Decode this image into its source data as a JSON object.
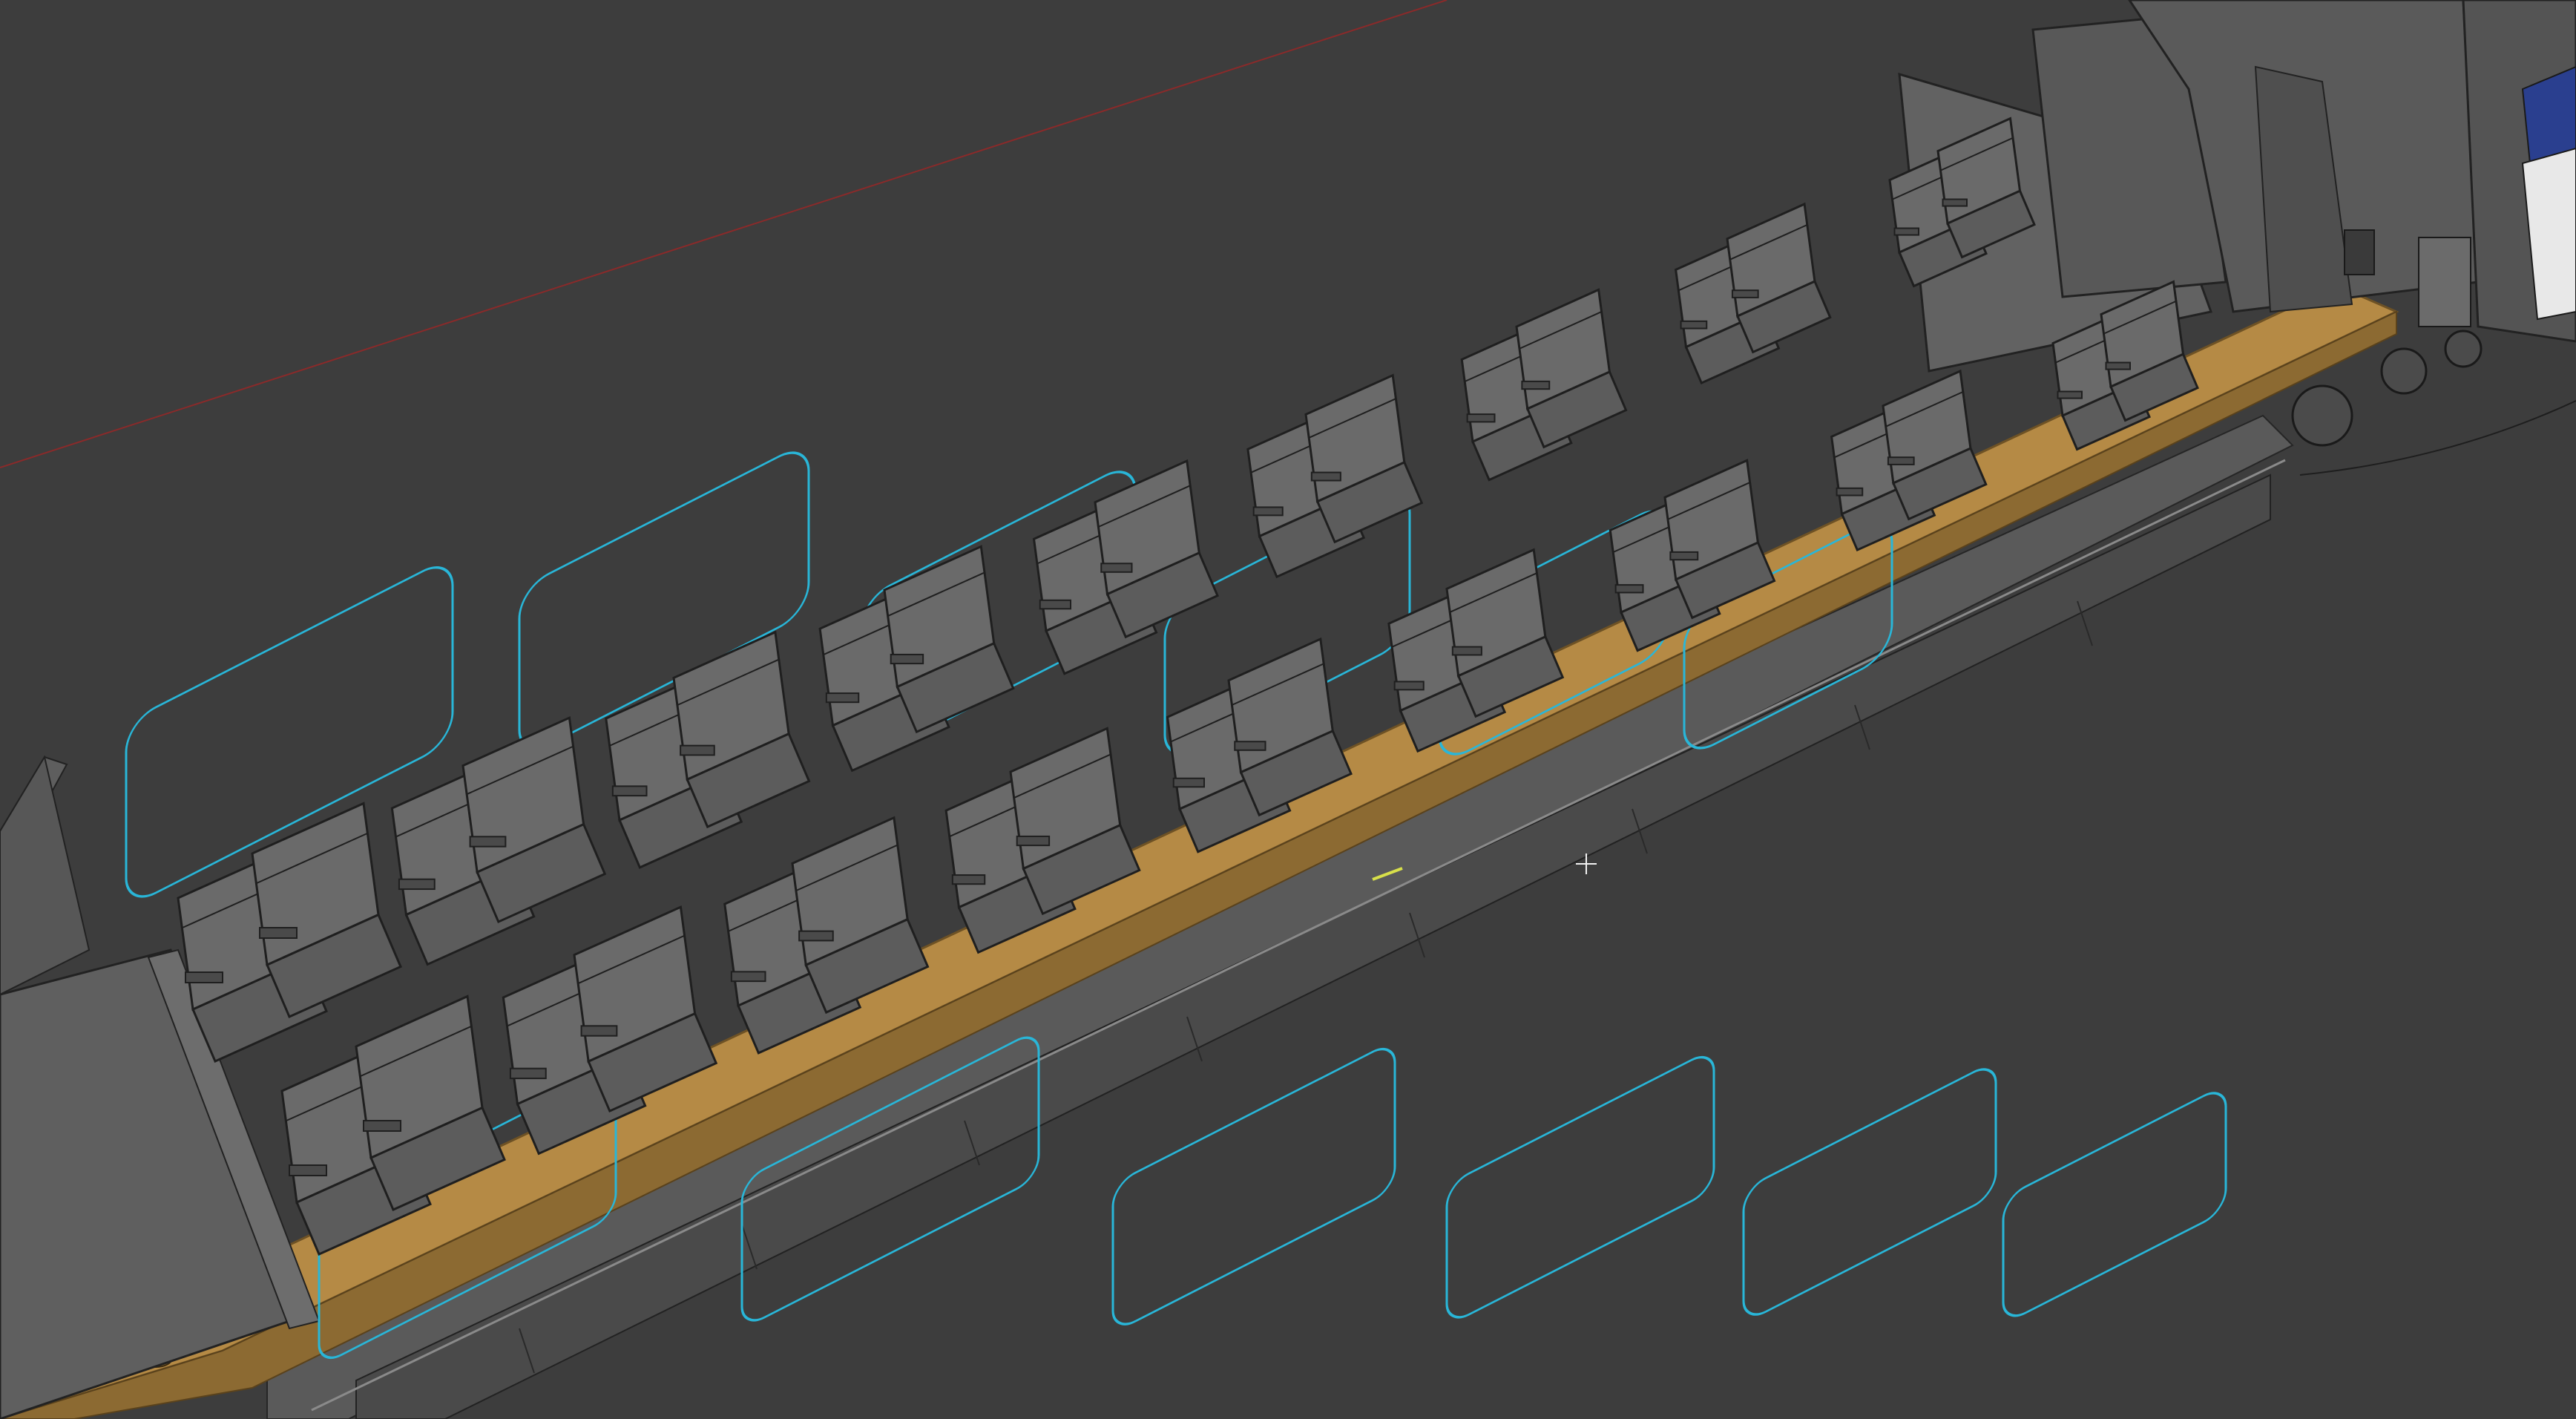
{
  "viewport": {
    "background": "#3d3d3d",
    "grid_axis_color": "#8a2a2a",
    "selection_outline_color": "#29b6d8",
    "floor_color": "#b58a45",
    "floor_edge_color": "#8c6a32",
    "seat_color": "#5c5c5c",
    "seat_edge_color": "#1f1f1f",
    "body_color": "#6a6a6a",
    "accent_blue": "#2a3f8f"
  },
  "scene": {
    "object_name": "passenger-railcar-interior",
    "seat_rows": 9,
    "seats_per_side": 2,
    "selected_elements": "window-frames"
  },
  "cursor": {
    "icon": "crosshair-icon"
  }
}
